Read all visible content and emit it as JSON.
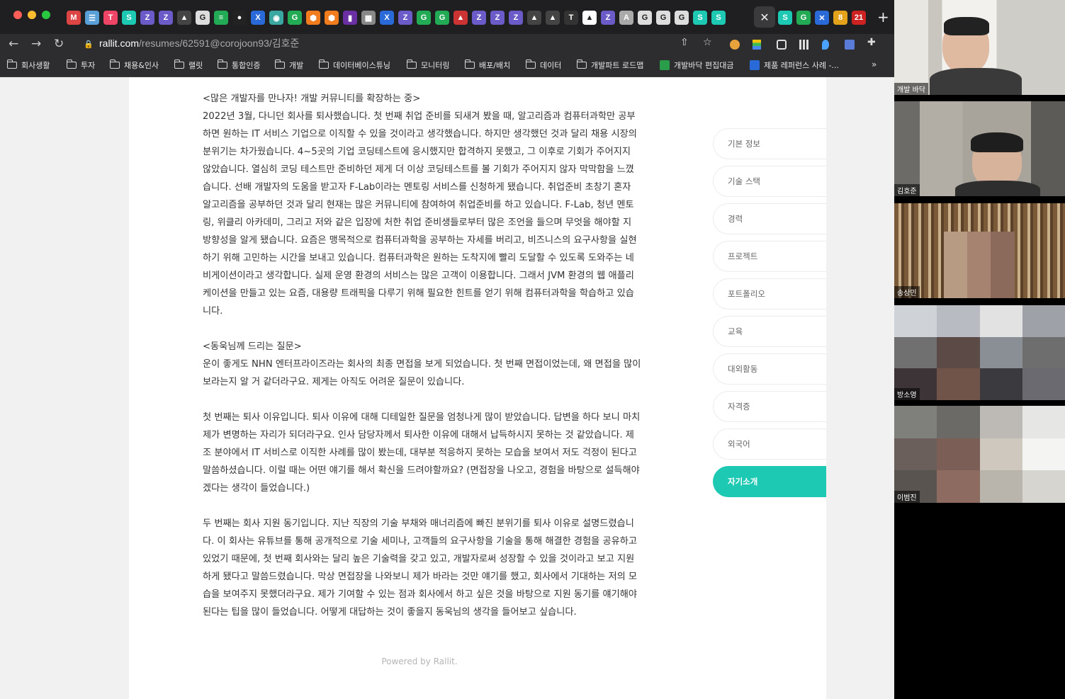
{
  "tabs": {
    "icons": [
      "M",
      "☰",
      "T",
      "S",
      "Z",
      "Z",
      "▲",
      "G",
      "≡",
      "●",
      "X",
      "◉",
      "G",
      "⬢",
      "⬢",
      "▮",
      "▦",
      "X",
      "Z",
      "G",
      "G",
      "▲",
      "Z",
      "Z",
      "Z",
      "▲",
      "▲",
      "T",
      "▲",
      "Z",
      "A",
      "G",
      "G",
      "G",
      "S",
      "S"
    ],
    "active_close": "✕",
    "tail_icons": [
      "S",
      "G",
      "✕",
      "8",
      "21"
    ],
    "new_tab": "+"
  },
  "toolbar": {
    "back": "←",
    "forward": "→",
    "reload": "↻",
    "url_host": "rallit.com",
    "url_path": "/resumes/62591@corojoon93/김호준",
    "share": "⇧",
    "star": "☆"
  },
  "bookmarks": {
    "items": [
      "회사생활",
      "투자",
      "채용&인사",
      "랠릿",
      "통합인증",
      "개발",
      "데이터베이스튜닝",
      "모니터링",
      "배포/배치",
      "데이터",
      "개발파트 로드맵",
      "개발바닥 편집대금",
      "제품 레퍼런스 사례 -..."
    ],
    "more": "»"
  },
  "resume": {
    "paragraphs": [
      "<많은 개발자를 만나자! 개발 커뮤니티를 확장하는 중>\n2022년 3월, 다니던 회사를 퇴사했습니다. 첫 번째 취업 준비를 되새겨 봤을 때, 알고리즘과 컴퓨터과학만 공부하면 원하는 IT 서비스 기업으로 이직할 수 있을 것이라고 생각했습니다. 하지만 생각했던 것과 달리 채용 시장의 분위기는 차가웠습니다. 4~5곳의 기업 코딩테스트에 응시했지만 합격하지 못했고, 그 이후로 기회가 주어지지 않았습니다. 열심히 코딩 테스트만 준비하던 제게 더 이상 코딩테스트를 볼 기회가 주어지지 않자 막막함을 느꼈습니다. 선배 개발자의 도움을 받고자 F-Lab이라는 멘토링 서비스를 신청하게 됐습니다. 취업준비 초창기 혼자 알고리즘을 공부하던 것과 달리 현재는 많은 커뮤니티에 참여하여 취업준비를 하고 있습니다. F-Lab, 청년 멘토링, 위클리 아카데미, 그리고 저와 같은 입장에 처한 취업 준비생들로부터 많은 조언을 들으며 무엇을 해야할 지 방향성을 알게 됐습니다. 요즘은 맹목적으로 컴퓨터과학을 공부하는 자세를 버리고, 비즈니스의 요구사항을 실현하기 위해 고민하는 시간을 보내고 있습니다. 컴퓨터과학은 원하는 도착지에 빨리 도달할 수 있도록 도와주는 네비게이션이라고 생각합니다. 실제 운영 환경의 서비스는 많은 고객이 이용합니다. 그래서 JVM 환경의 웹 애플리케이션을 만들고 있는 요즘, 대용량 트래픽을 다루기 위해 필요한 힌트를 얻기 위해 컴퓨터과학을 학습하고 있습니다.",
      "<동욱님께 드리는 질문>\n운이 좋게도 NHN 엔터프라이즈라는 회사의 최종 면접을 보게 되었습니다. 첫 번째 면접이었는데, 왜 면접을 많이 보라는지 알 거 같더라구요. 제게는 아직도 어려운 질문이 있습니다.",
      "첫 번째는 퇴사 이유입니다. 퇴사 이유에 대해 디테일한 질문을 엄청나게 많이 받았습니다. 답변을 하다 보니 마치 제가 변명하는 자리가 되더라구요. 인사 담당자께서 퇴사한 이유에 대해서 납득하시지 못하는 것 같았습니다. 제조 분야에서 IT 서비스로 이직한 사례를 많이 봤는데, 대부분 적응하지 못하는 모습을 보여서 저도 걱정이 된다고 말씀하셨습니다. 이럴 때는 어떤 얘기를 해서 확신을 드려야할까요? (면접장을 나오고, 경험을 바탕으로 설득해야겠다는 생각이 들었습니다.)",
      "두 번째는 회사 지원 동기입니다. 지난 직장의 기술 부채와 매너리즘에 빠진 분위기를 퇴사 이유로 설명드렸습니다. 이 회사는 유튜브를 통해 공개적으로 기술 세미나, 고객들의 요구사항을 기술을 통해 해결한 경험을 공유하고 있었기 때문에, 첫 번째 회사와는 달리 높은 기술력을 갖고 있고, 개발자로써 성장할 수 있을 것이라고 보고 지원하게 됐다고 말씀드렸습니다. 막상 면접장을 나와보니 제가 바라는 것만 얘기를 했고, 회사에서 기대하는 저의 모습을 보여주지 못했더라구요. 제가 기여할 수 있는 점과 회사에서 하고 싶은 것을 바탕으로 지원 동기를 얘기해야된다는 팁을 많이 들었습니다. 어떻게 대답하는 것이 좋을지 동욱님의 생각을 들어보고 싶습니다."
    ],
    "powered": "Powered by Rallit."
  },
  "sidenav": {
    "items": [
      "기본 정보",
      "기술 스택",
      "경력",
      "프로젝트",
      "포트폴리오",
      "교육",
      "대외활동",
      "자격증",
      "외국어",
      "자기소개"
    ],
    "active": "자기소개"
  },
  "participants": [
    {
      "name": "개발 바닥"
    },
    {
      "name": "김호준"
    },
    {
      "name": "송상민"
    },
    {
      "name": "방소영"
    },
    {
      "name": "이범진"
    }
  ],
  "colors": {
    "accent": "#1ec9b3",
    "tabstrip": "#1f1f21",
    "toolbar": "#2d2d30"
  }
}
